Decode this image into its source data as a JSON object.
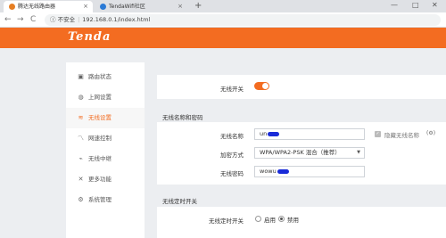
{
  "browser": {
    "tabs": [
      {
        "title": "腾达无线路由器",
        "active": true
      },
      {
        "title": "TendaWifi社区",
        "active": false
      }
    ],
    "new_tab_glyph": "+",
    "window_controls": {
      "minimize": "—",
      "maximize": "□",
      "close": "✕"
    },
    "nav": {
      "back": "←",
      "forward": "→",
      "reload": "C"
    },
    "address": {
      "security": "不安全",
      "url": "192.168.0.1/index.html"
    }
  },
  "brand": {
    "logo": "Tenda",
    "color": "#f36c21"
  },
  "sidebar": {
    "items": [
      {
        "label": "路由状态",
        "icon": "router-status-icon",
        "glyph": "▣",
        "active": false
      },
      {
        "label": "上网设置",
        "icon": "internet-globe-icon",
        "glyph": "◍",
        "active": false
      },
      {
        "label": "无线设置",
        "icon": "wifi-icon",
        "glyph": "≋",
        "active": true
      },
      {
        "label": "网速控制",
        "icon": "speed-chart-icon",
        "glyph": "〽",
        "active": false
      },
      {
        "label": "无线中继",
        "icon": "repeater-icon",
        "glyph": "⌁",
        "active": false
      },
      {
        "label": "更多功能",
        "icon": "tools-icon",
        "glyph": "✕",
        "active": false
      },
      {
        "label": "系统管理",
        "icon": "gear-icon",
        "glyph": "⚙",
        "active": false
      }
    ]
  },
  "wireless_switch": {
    "label": "无线开关",
    "on": true
  },
  "wireless_name_section": {
    "title": "无线名称和密码",
    "ssid_label": "无线名称",
    "ssid_value": "un",
    "hide_ssid_label": "隐藏无线名称",
    "hide_ssid_checked": true,
    "encryption_label": "加密方式",
    "encryption_value": "WPA/WPA2-PSK 混合（推荐）",
    "password_label": "无线密码",
    "password_value": "wowu"
  },
  "wireless_schedule_section": {
    "title": "无线定时开关",
    "switch_label": "无线定时开关",
    "options": [
      "启用",
      "禁用"
    ],
    "selected": "禁用"
  }
}
